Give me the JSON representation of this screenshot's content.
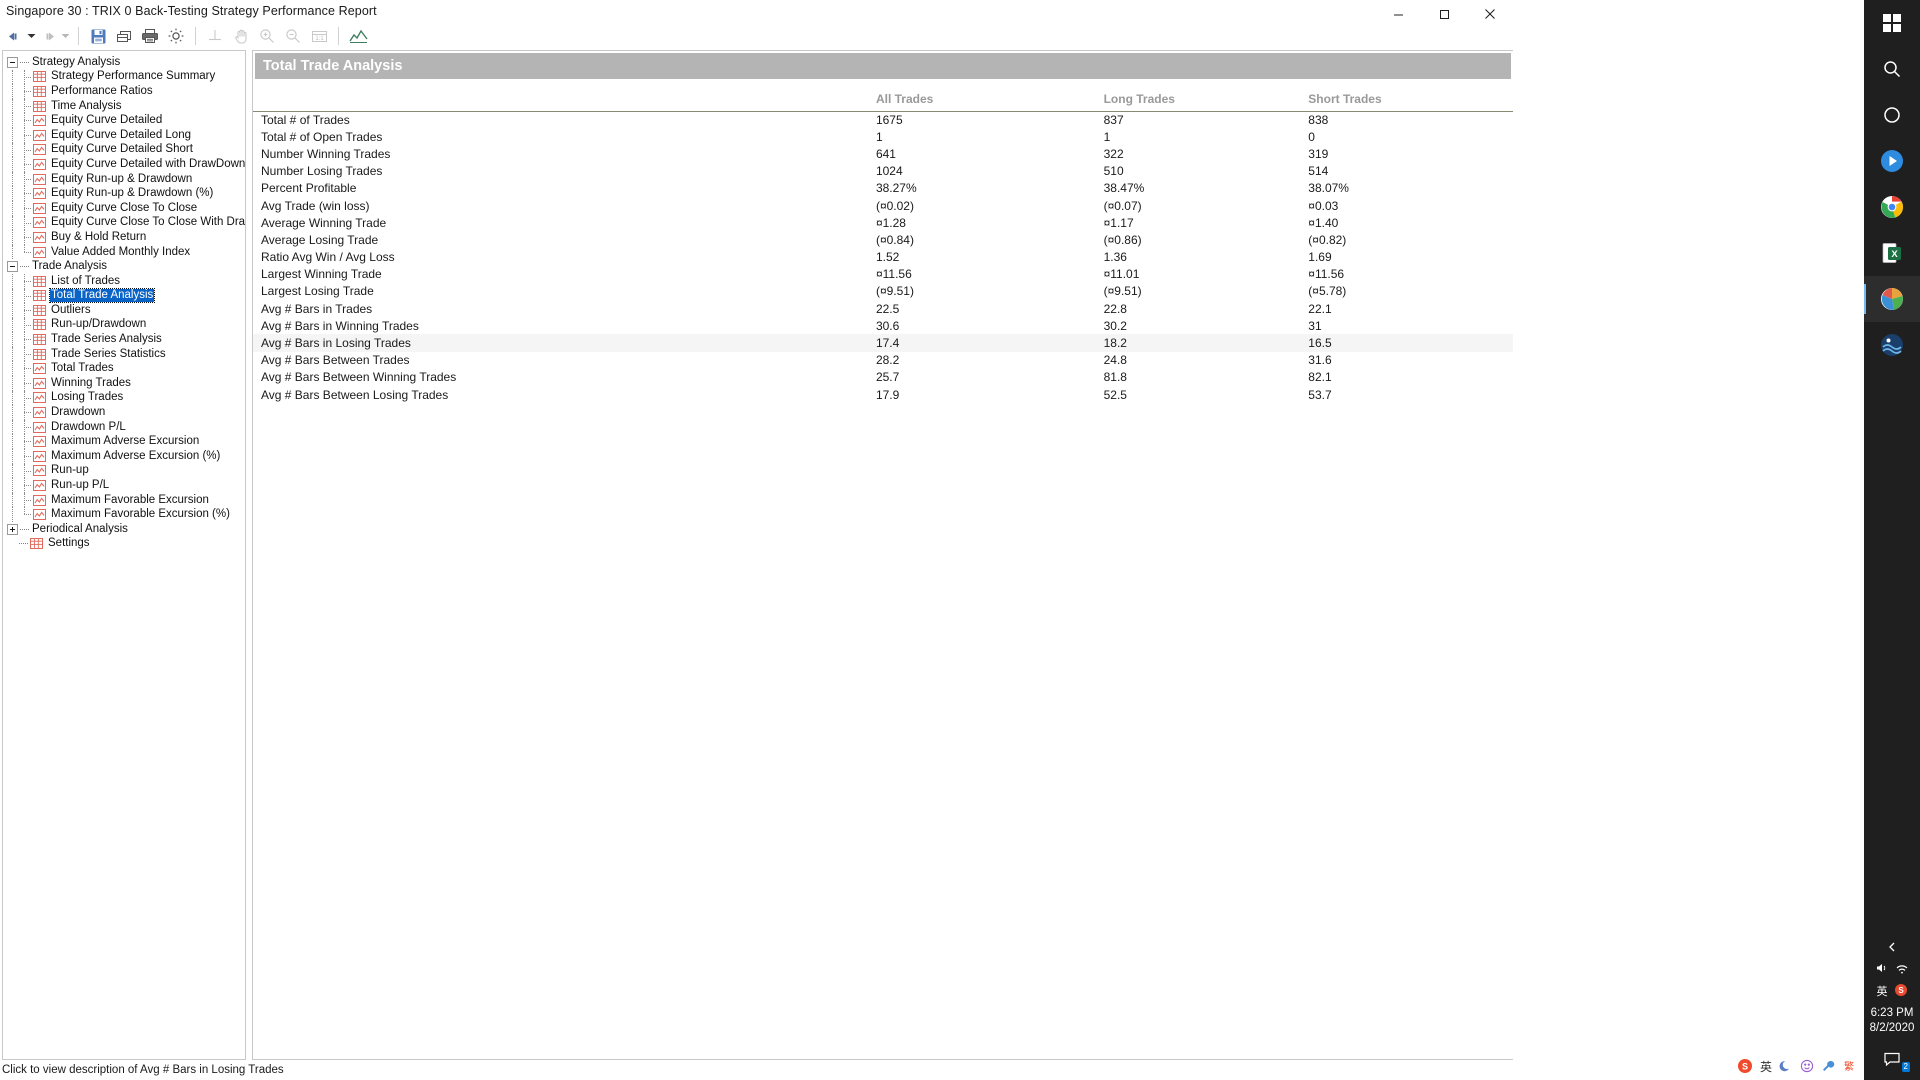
{
  "window": {
    "title": "Singapore 30 : TRIX 0 Back-Testing Strategy Performance Report",
    "minimize_label": "—",
    "maximize_label": "▢",
    "close_label": "✕"
  },
  "toolbar": {
    "items": [
      {
        "name": "nav-back",
        "label": "Back",
        "disabled": false
      },
      {
        "name": "nav-back-dropdown",
        "label": "Back history",
        "disabled": false
      },
      {
        "name": "nav-forward",
        "label": "Forward",
        "disabled": true
      },
      {
        "name": "nav-forward-dropdown",
        "label": "Forward history",
        "disabled": true
      },
      {
        "name": "save",
        "label": "Save",
        "disabled": false
      },
      {
        "name": "copy",
        "label": "Copy",
        "disabled": false
      },
      {
        "name": "print",
        "label": "Print",
        "disabled": false
      },
      {
        "name": "settings",
        "label": "Settings",
        "disabled": false
      },
      {
        "name": "crosshair",
        "label": "Crosshair",
        "disabled": true
      },
      {
        "name": "pan",
        "label": "Pan",
        "disabled": true
      },
      {
        "name": "zoom-in",
        "label": "Zoom In",
        "disabled": true
      },
      {
        "name": "zoom-out",
        "label": "Zoom Out",
        "disabled": true
      },
      {
        "name": "zoom-reset",
        "label": "1:1",
        "disabled": true
      },
      {
        "name": "chart-style",
        "label": "Chart Style",
        "disabled": false
      }
    ]
  },
  "tree": {
    "nodes": [
      {
        "label": "Strategy Analysis",
        "level": 0,
        "icon": "expander-minus",
        "type": "group",
        "selected": false
      },
      {
        "label": "Strategy Performance Summary",
        "level": 1,
        "icon": "grid-icon",
        "type": "leaf",
        "selected": false
      },
      {
        "label": "Performance Ratios",
        "level": 1,
        "icon": "grid-icon",
        "type": "leaf",
        "selected": false
      },
      {
        "label": "Time Analysis",
        "level": 1,
        "icon": "grid-icon",
        "type": "leaf",
        "selected": false
      },
      {
        "label": "Equity Curve Detailed",
        "level": 1,
        "icon": "chart-icon",
        "type": "leaf",
        "selected": false
      },
      {
        "label": "Equity Curve Detailed Long",
        "level": 1,
        "icon": "chart-icon",
        "type": "leaf",
        "selected": false
      },
      {
        "label": "Equity Curve Detailed Short",
        "level": 1,
        "icon": "chart-icon",
        "type": "leaf",
        "selected": false
      },
      {
        "label": "Equity Curve Detailed with DrawDown",
        "level": 1,
        "icon": "chart-icon",
        "type": "leaf",
        "selected": false
      },
      {
        "label": "Equity Run-up & Drawdown",
        "level": 1,
        "icon": "chart-icon",
        "type": "leaf",
        "selected": false
      },
      {
        "label": "Equity Run-up & Drawdown (%)",
        "level": 1,
        "icon": "chart-icon",
        "type": "leaf",
        "selected": false
      },
      {
        "label": "Equity Curve Close To Close",
        "level": 1,
        "icon": "chart-icon",
        "type": "leaf",
        "selected": false
      },
      {
        "label": "Equity Curve Close To Close With Drawdown",
        "level": 1,
        "icon": "chart-icon",
        "type": "leaf",
        "selected": false
      },
      {
        "label": "Buy & Hold Return",
        "level": 1,
        "icon": "chart-icon",
        "type": "leaf",
        "selected": false
      },
      {
        "label": "Value Added Monthly Index",
        "level": 1,
        "icon": "chart-icon",
        "type": "leaf-last",
        "selected": false
      },
      {
        "label": "Trade Analysis",
        "level": 0,
        "icon": "expander-minus",
        "type": "group",
        "selected": false
      },
      {
        "label": "List of Trades",
        "level": 1,
        "icon": "grid-icon",
        "type": "leaf",
        "selected": false
      },
      {
        "label": "Total Trade Analysis",
        "level": 1,
        "icon": "grid-icon",
        "type": "leaf",
        "selected": true
      },
      {
        "label": "Outliers",
        "level": 1,
        "icon": "grid-icon",
        "type": "leaf",
        "selected": false
      },
      {
        "label": "Run-up/Drawdown",
        "level": 1,
        "icon": "grid-icon",
        "type": "leaf",
        "selected": false
      },
      {
        "label": "Trade Series Analysis",
        "level": 1,
        "icon": "grid-icon",
        "type": "leaf",
        "selected": false
      },
      {
        "label": "Trade Series Statistics",
        "level": 1,
        "icon": "grid-icon",
        "type": "leaf",
        "selected": false
      },
      {
        "label": "Total Trades",
        "level": 1,
        "icon": "chart-icon",
        "type": "leaf",
        "selected": false
      },
      {
        "label": "Winning Trades",
        "level": 1,
        "icon": "chart-icon",
        "type": "leaf",
        "selected": false
      },
      {
        "label": "Losing Trades",
        "level": 1,
        "icon": "chart-icon",
        "type": "leaf",
        "selected": false
      },
      {
        "label": "Drawdown",
        "level": 1,
        "icon": "chart-icon",
        "type": "leaf",
        "selected": false
      },
      {
        "label": "Drawdown P/L",
        "level": 1,
        "icon": "chart-icon",
        "type": "leaf",
        "selected": false
      },
      {
        "label": "Maximum Adverse Excursion",
        "level": 1,
        "icon": "chart-icon",
        "type": "leaf",
        "selected": false
      },
      {
        "label": "Maximum Adverse Excursion (%)",
        "level": 1,
        "icon": "chart-icon",
        "type": "leaf",
        "selected": false
      },
      {
        "label": "Run-up",
        "level": 1,
        "icon": "chart-icon",
        "type": "leaf",
        "selected": false
      },
      {
        "label": "Run-up P/L",
        "level": 1,
        "icon": "chart-icon",
        "type": "leaf",
        "selected": false
      },
      {
        "label": "Maximum Favorable Excursion",
        "level": 1,
        "icon": "chart-icon",
        "type": "leaf",
        "selected": false
      },
      {
        "label": "Maximum Favorable Excursion (%)",
        "level": 1,
        "icon": "chart-icon",
        "type": "leaf-last",
        "selected": false
      },
      {
        "label": "Periodical Analysis",
        "level": 0,
        "icon": "expander-plus",
        "type": "group",
        "selected": false
      },
      {
        "label": "Settings",
        "level": 0,
        "icon": "grid-icon",
        "type": "root-leaf",
        "selected": false
      }
    ]
  },
  "report": {
    "title": "Total Trade Analysis",
    "columns": [
      "",
      "All Trades",
      "Long Trades",
      "Short Trades"
    ],
    "rows": [
      {
        "label": "Total # of Trades",
        "all": "1675",
        "long": "837",
        "short": "838",
        "neg": [
          false,
          false,
          false
        ],
        "hl": false
      },
      {
        "label": "Total # of Open Trades",
        "all": "1",
        "long": "1",
        "short": "0",
        "neg": [
          false,
          false,
          false
        ],
        "hl": false
      },
      {
        "label": "Number Winning Trades",
        "all": "641",
        "long": "322",
        "short": "319",
        "neg": [
          false,
          false,
          false
        ],
        "hl": false
      },
      {
        "label": "Number Losing Trades",
        "all": "1024",
        "long": "510",
        "short": "514",
        "neg": [
          false,
          false,
          false
        ],
        "hl": false
      },
      {
        "label": "Percent Profitable",
        "all": "38.27%",
        "long": "38.47%",
        "short": "38.07%",
        "neg": [
          false,
          false,
          false
        ],
        "hl": false
      },
      {
        "label": "Avg Trade (win  loss)",
        "all": "(¤0.02)",
        "long": "(¤0.07)",
        "short": "¤0.03",
        "neg": [
          true,
          true,
          false
        ],
        "hl": false
      },
      {
        "label": "Average Winning Trade",
        "all": "¤1.28",
        "long": "¤1.17",
        "short": "¤1.40",
        "neg": [
          false,
          false,
          false
        ],
        "hl": false
      },
      {
        "label": "Average Losing Trade",
        "all": "(¤0.84)",
        "long": "(¤0.86)",
        "short": "(¤0.82)",
        "neg": [
          true,
          true,
          true
        ],
        "hl": false
      },
      {
        "label": "Ratio Avg Win / Avg Loss",
        "all": "1.52",
        "long": "1.36",
        "short": "1.69",
        "neg": [
          false,
          false,
          false
        ],
        "hl": false
      },
      {
        "label": "Largest Winning Trade",
        "all": "¤11.56",
        "long": "¤11.01",
        "short": "¤11.56",
        "neg": [
          false,
          false,
          false
        ],
        "hl": false
      },
      {
        "label": "Largest Losing Trade",
        "all": "(¤9.51)",
        "long": "(¤9.51)",
        "short": "(¤5.78)",
        "neg": [
          true,
          true,
          true
        ],
        "hl": false
      },
      {
        "label": "Avg # Bars in Trades",
        "all": "22.5",
        "long": "22.8",
        "short": "22.1",
        "neg": [
          false,
          false,
          false
        ],
        "hl": false
      },
      {
        "label": "Avg # Bars in Winning Trades",
        "all": "30.6",
        "long": "30.2",
        "short": "31",
        "neg": [
          false,
          false,
          false
        ],
        "hl": false
      },
      {
        "label": "Avg # Bars in Losing Trades",
        "all": "17.4",
        "long": "18.2",
        "short": "16.5",
        "neg": [
          false,
          false,
          false
        ],
        "hl": true
      },
      {
        "label": "Avg # Bars Between Trades",
        "all": "28.2",
        "long": "24.8",
        "short": "31.6",
        "neg": [
          false,
          false,
          false
        ],
        "hl": false
      },
      {
        "label": "Avg # Bars Between Winning Trades",
        "all": "25.7",
        "long": "81.8",
        "short": "82.1",
        "neg": [
          false,
          false,
          false
        ],
        "hl": false
      },
      {
        "label": "Avg # Bars Between Losing Trades",
        "all": "17.9",
        "long": "52.5",
        "short": "53.7",
        "neg": [
          false,
          false,
          false
        ],
        "hl": false
      }
    ]
  },
  "statusbar": {
    "text": "Click to view description of Avg # Bars in Losing Trades"
  },
  "taskbar": {
    "items": [
      {
        "name": "start-icon",
        "label": "Start"
      },
      {
        "name": "search-icon",
        "label": "Search"
      },
      {
        "name": "cortana-icon",
        "label": "Cortana"
      },
      {
        "name": "media-player-icon",
        "label": "Media Player"
      },
      {
        "name": "chrome-icon",
        "label": "Chrome"
      },
      {
        "name": "excel-icon",
        "label": "Excel"
      },
      {
        "name": "analysis-app-icon",
        "label": "Strategy Report",
        "active": true
      },
      {
        "name": "ocean-app-icon",
        "label": "Platform"
      }
    ],
    "tray": {
      "chevron": "‹",
      "volume_label": "Volume",
      "network_label": "Network",
      "ime_label": "英",
      "ime_tool_label": "S",
      "time": "6:23 PM",
      "date": "8/2/2020",
      "notification_badge": "2"
    },
    "ime": {
      "logo": "S",
      "mode": "英",
      "moon": "☾",
      "smiley": "☺",
      "tool": "🔧",
      "lang": "繁"
    }
  },
  "colors": {
    "accent": "#0a64c8",
    "negative": "#ff0000",
    "header_bg": "#b4b4b4",
    "tree_icon": "#e8756b"
  }
}
